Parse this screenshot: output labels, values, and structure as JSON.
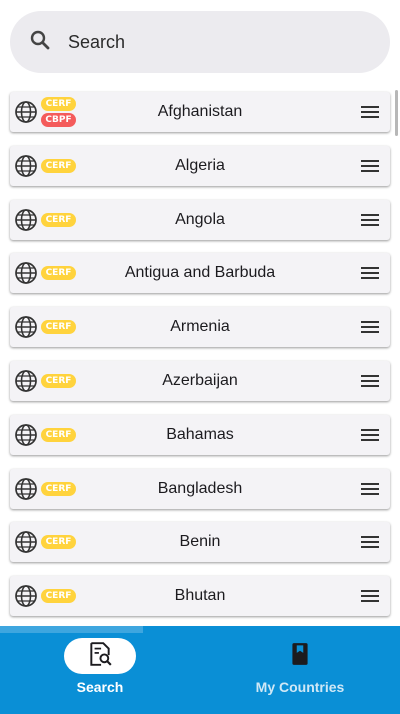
{
  "search": {
    "placeholder": "Search"
  },
  "countries": [
    {
      "name": "Afghanistan",
      "badges": [
        "CERF",
        "CBPF"
      ]
    },
    {
      "name": "Algeria",
      "badges": [
        "CERF"
      ]
    },
    {
      "name": "Angola",
      "badges": [
        "CERF"
      ]
    },
    {
      "name": "Antigua and Barbuda",
      "badges": [
        "CERF"
      ]
    },
    {
      "name": "Armenia",
      "badges": [
        "CERF"
      ]
    },
    {
      "name": "Azerbaijan",
      "badges": [
        "CERF"
      ]
    },
    {
      "name": "Bahamas",
      "badges": [
        "CERF"
      ]
    },
    {
      "name": "Bangladesh",
      "badges": [
        "CERF"
      ]
    },
    {
      "name": "Benin",
      "badges": [
        "CERF"
      ]
    },
    {
      "name": "Bhutan",
      "badges": [
        "CERF"
      ]
    }
  ],
  "nav": {
    "search_label": "Search",
    "my_countries_label": "My Countries"
  },
  "colors": {
    "nav_background": "#0a8fd6",
    "cerf_badge": "#ffd33d",
    "cbpf_badge": "#f45b5b",
    "search_background": "#ecebef"
  },
  "icons": {
    "search": "search-icon",
    "globe": "globe-icon",
    "menu": "drag-handle-icon",
    "nav_search": "search-document-icon",
    "nav_my_countries": "bookmark-book-icon"
  }
}
